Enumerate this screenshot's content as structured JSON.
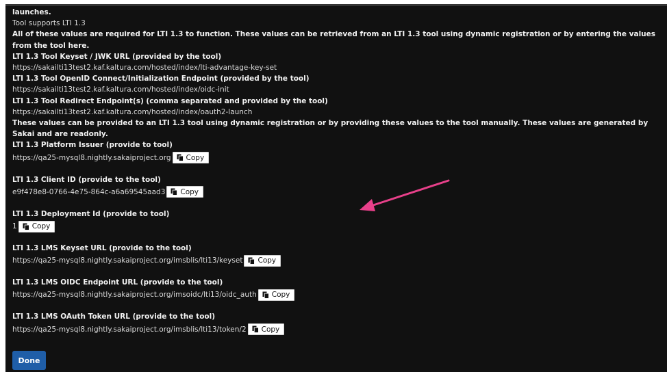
{
  "header": {
    "launches_text": "launches.",
    "supports_text": "Tool supports LTI 1.3",
    "required_notice": "All of these values are required for LTI 1.3 to function. These values can be retrieved from an LTI 1.3 tool using dynamic registration or by entering the values from the tool here."
  },
  "tool_values": [
    {
      "label": "LTI 1.3 Tool Keyset / JWK URL (provided by the tool)",
      "value": "https://sakailti13test2.kaf.kaltura.com/hosted/index/lti-advantage-key-set"
    },
    {
      "label": "LTI 1.3 Tool OpenID Connect/Initialization Endpoint (provided by the tool)",
      "value": "https://sakailti13test2.kaf.kaltura.com/hosted/index/oidc-init"
    },
    {
      "label": "LTI 1.3 Tool Redirect Endpoint(s) (comma separated and provided by the tool)",
      "value": "https://sakailti13test2.kaf.kaltura.com/hosted/index/oauth2-launch"
    }
  ],
  "provided_notice": "These values can be provided to an LTI 1.3 tool using dynamic registration or by providing these values to the tool manually. These values are generated by Sakai and are readonly.",
  "platform_values": [
    {
      "label": "LTI 1.3 Platform Issuer (provide to tool)",
      "value": "https://qa25-mysql8.nightly.sakaiproject.org",
      "copy_label": "Copy"
    },
    {
      "label": "LTI 1.3 Client ID (provide to the tool)",
      "value": "e9f478e8-0766-4e75-864c-a6a69545aad3",
      "copy_label": "Copy"
    },
    {
      "label": "LTI 1.3 Deployment Id (provide to tool)",
      "value": "1",
      "copy_label": "Copy"
    },
    {
      "label": "LTI 1.3 LMS Keyset URL (provide to the tool)",
      "value": "https://qa25-mysql8.nightly.sakaiproject.org/imsblis/lti13/keyset",
      "copy_label": "Copy"
    },
    {
      "label": "LTI 1.3 LMS OIDC Endpoint URL (provide to the tool)",
      "value": "https://qa25-mysql8.nightly.sakaiproject.org/imsoidc/lti13/oidc_auth",
      "copy_label": "Copy"
    },
    {
      "label": "LTI 1.3 LMS OAuth Token URL (provide to the tool)",
      "value": "https://qa25-mysql8.nightly.sakaiproject.org/imsblis/lti13/token/2",
      "copy_label": "Copy"
    }
  ],
  "footer": {
    "done_label": "Done"
  },
  "icons": {
    "copy": "copy-icon",
    "annotation": "arrow-icon"
  },
  "colors": {
    "background": "#111111",
    "text": "#e2e2e2",
    "done_button": "#1f5ea8",
    "annotation_arrow": "#e8408a"
  }
}
